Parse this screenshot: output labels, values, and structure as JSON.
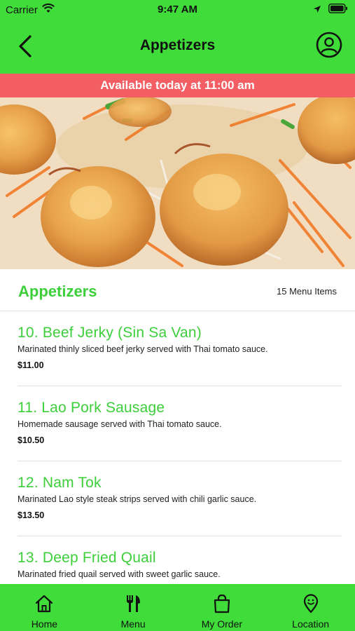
{
  "status_bar": {
    "carrier": "Carrier",
    "time": "9:47 AM",
    "icons": [
      "wifi-icon",
      "location-arrow-icon",
      "battery-icon"
    ]
  },
  "nav": {
    "title": "Appetizers",
    "back_icon": "chevron-left-icon",
    "profile_icon": "user-circle-icon"
  },
  "banner": {
    "text": "Available today at 11:00 am"
  },
  "hero": {
    "alt": "shrimp appetizer photo"
  },
  "section": {
    "title": "Appetizers",
    "count": "15 Menu Items"
  },
  "menu_items": [
    {
      "name": "10. Beef Jerky (Sin Sa Van)",
      "description": "Marinated thinly sliced beef jerky served with Thai tomato sauce.",
      "price": "$11.00"
    },
    {
      "name": "11. Lao Pork Sausage",
      "description": "Homemade sausage served with Thai tomato sauce.",
      "price": "$10.50"
    },
    {
      "name": "12. Nam Tok",
      "description": "Marinated Lao style steak strips served with chili garlic sauce.",
      "price": "$13.50"
    },
    {
      "name": "13. Deep Fried Quail",
      "description": "Marinated fried quail served with sweet garlic sauce.",
      "price": ""
    }
  ],
  "tabs": [
    {
      "label": "Home",
      "icon": "home-icon"
    },
    {
      "label": "Menu",
      "icon": "fork-knife-icon"
    },
    {
      "label": "My Order",
      "icon": "shopping-bag-icon"
    },
    {
      "label": "Location",
      "icon": "location-pin-icon"
    }
  ],
  "colors": {
    "brand_green": "#3fdc3a",
    "text_green": "#3ccf3a",
    "banner_red": "#f25e63"
  }
}
